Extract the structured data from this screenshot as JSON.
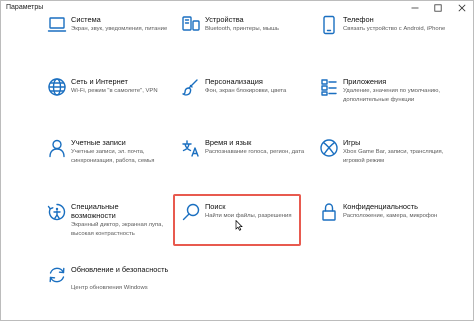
{
  "window": {
    "title": "Параметры"
  },
  "tiles": [
    {
      "name": "Система",
      "desc": "Экран, звук, уведомления, питание",
      "icon": "laptop-icon"
    },
    {
      "name": "Устройства",
      "desc": "Bluetooth, принтеры, мышь",
      "icon": "devices-icon"
    },
    {
      "name": "Телефон",
      "desc": "Связать устройство с Android, iPhone",
      "icon": "phone-icon"
    },
    {
      "name": "Сеть и Интернет",
      "desc": "Wi-Fi, режим \"в самолете\", VPN",
      "icon": "globe-icon"
    },
    {
      "name": "Персонализация",
      "desc": "Фон, экран блокировки, цвета",
      "icon": "paintbrush-icon"
    },
    {
      "name": "Приложения",
      "desc": "Удаление, значения по умолчанию, дополнительные функции",
      "icon": "apps-icon"
    },
    {
      "name": "Учетные записи",
      "desc": "Учетные записи, эл. почта, синхронизация, работа, семья",
      "icon": "person-icon"
    },
    {
      "name": "Время и язык",
      "desc": "Распознавание голоса, регион, дата",
      "icon": "language-icon"
    },
    {
      "name": "Игры",
      "desc": "Xbox Game Bar, записи, трансляция, игровой режим",
      "icon": "xbox-icon"
    },
    {
      "name": "Специальные возможности",
      "desc": "Экранный диктор, экранная лупа, высокая контрастность",
      "icon": "accessibility-icon"
    },
    {
      "name": "Поиск",
      "desc": "Найти мои файлы, разрешения",
      "icon": "search-icon"
    },
    {
      "name": "Конфиденциальность",
      "desc": "Расположение, камера, микрофон",
      "icon": "lock-icon"
    },
    {
      "name": "Обновление и безопасность",
      "desc": "Центр обновления Windows",
      "icon": "update-icon"
    }
  ],
  "colors": {
    "accent": "#1a6fc0",
    "highlight": "#e85a4f"
  }
}
